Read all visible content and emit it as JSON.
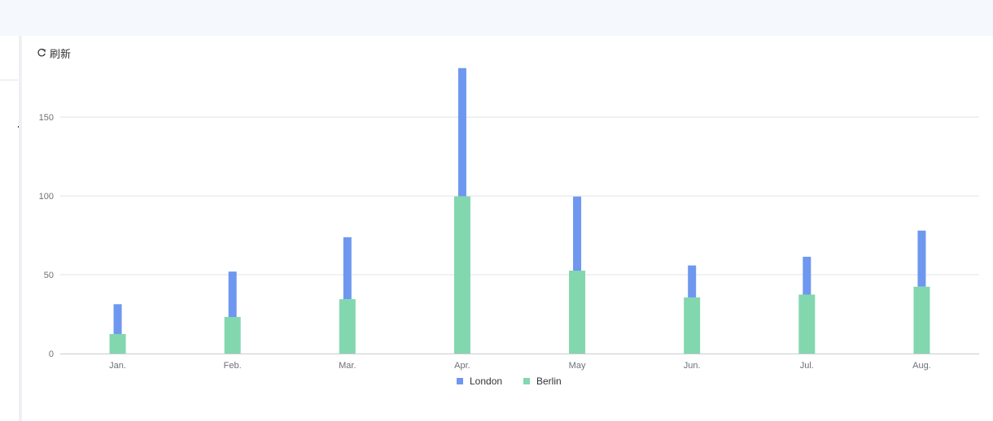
{
  "toolbar": {
    "refresh_label": "刷新",
    "refresh_icon": "refresh-icon"
  },
  "colors": {
    "london": "#6e97f0",
    "berlin": "#82d7ae",
    "topbar": "#f5f8fc",
    "grid": "#e0e3e8",
    "axis": "#c8ccd2"
  },
  "chart_data": {
    "type": "bar",
    "stacked": true,
    "categories": [
      "Jan.",
      "Feb.",
      "Mar.",
      "Apr.",
      "May",
      "Jun.",
      "Jul.",
      "Aug."
    ],
    "series": [
      {
        "name": "Berlin",
        "values": [
          12.4,
          23.2,
          34.5,
          99.7,
          52.6,
          35.6,
          37.4,
          42.4
        ]
      },
      {
        "name": "London",
        "values": [
          18.9,
          28.8,
          39.3,
          81.4,
          47.0,
          20.3,
          24.0,
          35.6
        ]
      }
    ],
    "yticks": [
      0,
      50,
      100,
      150
    ],
    "ylim": [
      0,
      181
    ],
    "grid": true,
    "legend_position": "bottom-center",
    "title": "",
    "xlabel": "",
    "ylabel": ""
  }
}
